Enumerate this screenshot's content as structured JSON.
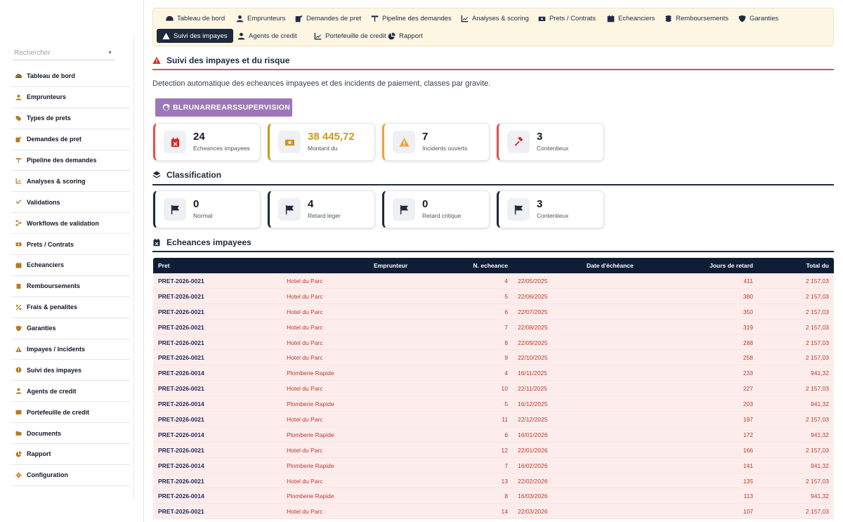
{
  "colors": {
    "navy": "#0f1d36",
    "accent_red": "#dc2626",
    "gold": "#c99a1d",
    "orange": "#f0a040",
    "purple_button": "#9d77b8",
    "row_bg": "#fdecec"
  },
  "sidebar": {
    "search_placeholder": "Rechercher",
    "items": [
      {
        "label": "Tableau de bord",
        "icon": "dashboard-icon"
      },
      {
        "label": "Emprunteurs",
        "icon": "user-icon"
      },
      {
        "label": "Types de prets",
        "icon": "tags-icon"
      },
      {
        "label": "Demandes de pret",
        "icon": "edit-icon"
      },
      {
        "label": "Pipeline des demandes",
        "icon": "columns-icon"
      },
      {
        "label": "Analyses & scoring",
        "icon": "chart-icon"
      },
      {
        "label": "Validations",
        "icon": "check-icon"
      },
      {
        "label": "Workflows de validation",
        "icon": "flow-icon"
      },
      {
        "label": "Prets / Contrats",
        "icon": "money-icon"
      },
      {
        "label": "Echeanciers",
        "icon": "calendar-icon"
      },
      {
        "label": "Remboursements",
        "icon": "coins-icon"
      },
      {
        "label": "Frais & penalites",
        "icon": "percent-icon"
      },
      {
        "label": "Garanties",
        "icon": "shield-icon"
      },
      {
        "label": "Impayes / Incidents",
        "icon": "warning-icon"
      },
      {
        "label": "Suivi des impayes",
        "icon": "exclamation-icon"
      },
      {
        "label": "Agents de credit",
        "icon": "user-tie-icon"
      },
      {
        "label": "Portefeuille de credit",
        "icon": "wallet-icon"
      },
      {
        "label": "Documents",
        "icon": "folder-icon"
      },
      {
        "label": "Rapport",
        "icon": "pie-icon"
      },
      {
        "label": "Configuration",
        "icon": "gear-icon"
      }
    ]
  },
  "topnav": {
    "row1": [
      {
        "label": "Tableau de bord",
        "icon": "dashboard-icon"
      },
      {
        "label": "Emprunteurs",
        "icon": "user-icon"
      },
      {
        "label": "Demandes de pret",
        "icon": "edit-icon"
      },
      {
        "label": "Pipeline des demandes",
        "icon": "columns-icon"
      },
      {
        "label": "Analyses & scoring",
        "icon": "chart-icon"
      },
      {
        "label": "Prets / Contrats",
        "icon": "money-icon"
      },
      {
        "label": "Echeanciers",
        "icon": "calendar-icon"
      },
      {
        "label": "Remboursements",
        "icon": "coins-icon"
      },
      {
        "label": "Garanties",
        "icon": "shield-icon"
      }
    ],
    "row2": [
      {
        "label": "Suivi des impayes",
        "icon": "warning-icon",
        "active": true
      },
      {
        "label": "Agents de credit",
        "icon": "user-tie-icon"
      },
      {
        "label": "Portefeuille de credit",
        "icon": "chart-icon"
      },
      {
        "label": "Rapport",
        "icon": "pie-icon"
      }
    ]
  },
  "page": {
    "title": "Suivi des impayes et du risque",
    "description": "Detection automatique des echeances impayees et des incidents de paiement, classes par gravite.",
    "action_button": "BLRUNARREARSSUPERVISION"
  },
  "stats": [
    {
      "value": "24",
      "label": "Echeances impayees",
      "icon": "calendar-x-icon"
    },
    {
      "value": "38 445,72",
      "label": "Montant du",
      "icon": "money-icon"
    },
    {
      "value": "7",
      "label": "Incidents ouverts",
      "icon": "warning-icon"
    },
    {
      "value": "3",
      "label": "Contentieux",
      "icon": "gavel-icon"
    }
  ],
  "classification": {
    "title": "Classification",
    "cards": [
      {
        "value": "0",
        "label": "Normal",
        "icon": "flag-icon"
      },
      {
        "value": "4",
        "label": "Retard leger",
        "icon": "flag-icon"
      },
      {
        "value": "0",
        "label": "Retard critique",
        "icon": "flag-icon"
      },
      {
        "value": "3",
        "label": "Contentieux",
        "icon": "flag-icon"
      }
    ]
  },
  "table": {
    "title": "Echeances impayees",
    "headers": {
      "pret": "Pret",
      "emprunteur": "Emprunteur",
      "echeance": "N. echeance",
      "date": "Date d'échéance",
      "jours": "Jours de retard",
      "total": "Total du"
    },
    "rows": [
      {
        "pret": "PRET-2026-0021",
        "emprunteur": "Hotel du Parc",
        "echeance": "4",
        "date": "22/05/2025",
        "jours": "411",
        "total": "2 157,03"
      },
      {
        "pret": "PRET-2026-0021",
        "emprunteur": "Hotel du Parc",
        "echeance": "5",
        "date": "22/06/2025",
        "jours": "380",
        "total": "2 157,03"
      },
      {
        "pret": "PRET-2026-0021",
        "emprunteur": "Hotel du Parc",
        "echeance": "6",
        "date": "22/07/2025",
        "jours": "350",
        "total": "2 157,03"
      },
      {
        "pret": "PRET-2026-0021",
        "emprunteur": "Hotel du Parc",
        "echeance": "7",
        "date": "22/08/2025",
        "jours": "319",
        "total": "2 157,03"
      },
      {
        "pret": "PRET-2026-0021",
        "emprunteur": "Hotel du Parc",
        "echeance": "8",
        "date": "22/09/2025",
        "jours": "288",
        "total": "2 157,03"
      },
      {
        "pret": "PRET-2026-0021",
        "emprunteur": "Hotel du Parc",
        "echeance": "9",
        "date": "22/10/2025",
        "jours": "258",
        "total": "2 157,03"
      },
      {
        "pret": "PRET-2026-0014",
        "emprunteur": "Plomberie Rapide",
        "echeance": "4",
        "date": "16/11/2025",
        "jours": "233",
        "total": "941,32"
      },
      {
        "pret": "PRET-2026-0021",
        "emprunteur": "Hotel du Parc",
        "echeance": "10",
        "date": "22/11/2025",
        "jours": "227",
        "total": "2 157,03"
      },
      {
        "pret": "PRET-2026-0014",
        "emprunteur": "Plomberie Rapide",
        "echeance": "5",
        "date": "16/12/2025",
        "jours": "203",
        "total": "941,32"
      },
      {
        "pret": "PRET-2026-0021",
        "emprunteur": "Hotel du Parc",
        "echeance": "11",
        "date": "22/12/2025",
        "jours": "197",
        "total": "2 157,03"
      },
      {
        "pret": "PRET-2026-0014",
        "emprunteur": "Plomberie Rapide",
        "echeance": "6",
        "date": "16/01/2026",
        "jours": "172",
        "total": "941,32"
      },
      {
        "pret": "PRET-2026-0021",
        "emprunteur": "Hotel du Parc",
        "echeance": "12",
        "date": "22/01/2026",
        "jours": "166",
        "total": "2 157,03"
      },
      {
        "pret": "PRET-2026-0014",
        "emprunteur": "Plomberie Rapide",
        "echeance": "7",
        "date": "16/02/2026",
        "jours": "141",
        "total": "941,32"
      },
      {
        "pret": "PRET-2026-0021",
        "emprunteur": "Hotel du Parc",
        "echeance": "13",
        "date": "22/02/2026",
        "jours": "135",
        "total": "2 157,03"
      },
      {
        "pret": "PRET-2026-0014",
        "emprunteur": "Plomberie Rapide",
        "echeance": "8",
        "date": "16/03/2026",
        "jours": "113",
        "total": "941,32"
      },
      {
        "pret": "PRET-2026-0021",
        "emprunteur": "Hotel du Parc",
        "echeance": "14",
        "date": "22/03/2026",
        "jours": "107",
        "total": "2 157,03"
      }
    ]
  }
}
